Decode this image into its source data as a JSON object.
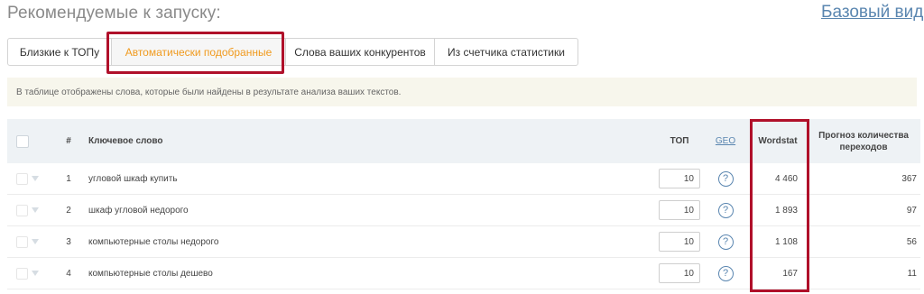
{
  "header": {
    "title": "Рекомендуемые к запуску:",
    "view_link": "Базовый вид"
  },
  "tabs": [
    {
      "label": "Близкие к ТОПу",
      "active": false
    },
    {
      "label": "Автоматически подобранные",
      "active": true
    },
    {
      "label": "Слова ваших конкурентов",
      "active": false
    },
    {
      "label": "Из счетчика статистики",
      "active": false
    }
  ],
  "notice": "В таблице отображены слова, которые были найдены в результате анализа ваших текстов.",
  "table": {
    "columns": {
      "num": "#",
      "keyword": "Ключевое слово",
      "top": "ТОП",
      "geo": "GEO",
      "wordstat": "Wordstat",
      "forecast": "Прогноз количества переходов"
    },
    "help_icon": "?",
    "rows": [
      {
        "num": "1",
        "keyword": "угловой шкаф купить",
        "top": "10",
        "wordstat": "4 460",
        "forecast": "367"
      },
      {
        "num": "2",
        "keyword": "шкаф угловой недорого",
        "top": "10",
        "wordstat": "1 893",
        "forecast": "97"
      },
      {
        "num": "3",
        "keyword": "компьютерные столы недорого",
        "top": "10",
        "wordstat": "1 108",
        "forecast": "56"
      },
      {
        "num": "4",
        "keyword": "компьютерные столы дешево",
        "top": "10",
        "wordstat": "167",
        "forecast": "11"
      }
    ]
  },
  "colors": {
    "active_tab_text": "#f09a1e",
    "highlight_border": "#b0102a",
    "link": "#5a86b0",
    "notice_bg": "#f7f6ec",
    "table_header_bg": "#eef2f5"
  },
  "icons": {
    "geo_help": "question-circle-icon",
    "row_menu": "caret-down-icon"
  }
}
